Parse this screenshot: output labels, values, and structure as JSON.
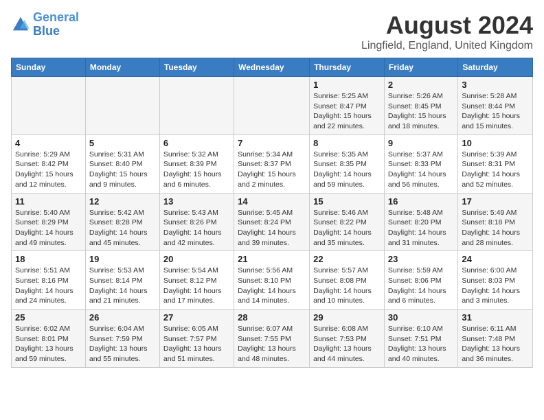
{
  "header": {
    "logo_line1": "General",
    "logo_line2": "Blue",
    "main_title": "August 2024",
    "subtitle": "Lingfield, England, United Kingdom"
  },
  "days_of_week": [
    "Sunday",
    "Monday",
    "Tuesday",
    "Wednesday",
    "Thursday",
    "Friday",
    "Saturday"
  ],
  "weeks": [
    [
      {
        "num": "",
        "info": ""
      },
      {
        "num": "",
        "info": ""
      },
      {
        "num": "",
        "info": ""
      },
      {
        "num": "",
        "info": ""
      },
      {
        "num": "1",
        "info": "Sunrise: 5:25 AM\nSunset: 8:47 PM\nDaylight: 15 hours\nand 22 minutes."
      },
      {
        "num": "2",
        "info": "Sunrise: 5:26 AM\nSunset: 8:45 PM\nDaylight: 15 hours\nand 18 minutes."
      },
      {
        "num": "3",
        "info": "Sunrise: 5:28 AM\nSunset: 8:44 PM\nDaylight: 15 hours\nand 15 minutes."
      }
    ],
    [
      {
        "num": "4",
        "info": "Sunrise: 5:29 AM\nSunset: 8:42 PM\nDaylight: 15 hours\nand 12 minutes."
      },
      {
        "num": "5",
        "info": "Sunrise: 5:31 AM\nSunset: 8:40 PM\nDaylight: 15 hours\nand 9 minutes."
      },
      {
        "num": "6",
        "info": "Sunrise: 5:32 AM\nSunset: 8:39 PM\nDaylight: 15 hours\nand 6 minutes."
      },
      {
        "num": "7",
        "info": "Sunrise: 5:34 AM\nSunset: 8:37 PM\nDaylight: 15 hours\nand 2 minutes."
      },
      {
        "num": "8",
        "info": "Sunrise: 5:35 AM\nSunset: 8:35 PM\nDaylight: 14 hours\nand 59 minutes."
      },
      {
        "num": "9",
        "info": "Sunrise: 5:37 AM\nSunset: 8:33 PM\nDaylight: 14 hours\nand 56 minutes."
      },
      {
        "num": "10",
        "info": "Sunrise: 5:39 AM\nSunset: 8:31 PM\nDaylight: 14 hours\nand 52 minutes."
      }
    ],
    [
      {
        "num": "11",
        "info": "Sunrise: 5:40 AM\nSunset: 8:29 PM\nDaylight: 14 hours\nand 49 minutes."
      },
      {
        "num": "12",
        "info": "Sunrise: 5:42 AM\nSunset: 8:28 PM\nDaylight: 14 hours\nand 45 minutes."
      },
      {
        "num": "13",
        "info": "Sunrise: 5:43 AM\nSunset: 8:26 PM\nDaylight: 14 hours\nand 42 minutes."
      },
      {
        "num": "14",
        "info": "Sunrise: 5:45 AM\nSunset: 8:24 PM\nDaylight: 14 hours\nand 39 minutes."
      },
      {
        "num": "15",
        "info": "Sunrise: 5:46 AM\nSunset: 8:22 PM\nDaylight: 14 hours\nand 35 minutes."
      },
      {
        "num": "16",
        "info": "Sunrise: 5:48 AM\nSunset: 8:20 PM\nDaylight: 14 hours\nand 31 minutes."
      },
      {
        "num": "17",
        "info": "Sunrise: 5:49 AM\nSunset: 8:18 PM\nDaylight: 14 hours\nand 28 minutes."
      }
    ],
    [
      {
        "num": "18",
        "info": "Sunrise: 5:51 AM\nSunset: 8:16 PM\nDaylight: 14 hours\nand 24 minutes."
      },
      {
        "num": "19",
        "info": "Sunrise: 5:53 AM\nSunset: 8:14 PM\nDaylight: 14 hours\nand 21 minutes."
      },
      {
        "num": "20",
        "info": "Sunrise: 5:54 AM\nSunset: 8:12 PM\nDaylight: 14 hours\nand 17 minutes."
      },
      {
        "num": "21",
        "info": "Sunrise: 5:56 AM\nSunset: 8:10 PM\nDaylight: 14 hours\nand 14 minutes."
      },
      {
        "num": "22",
        "info": "Sunrise: 5:57 AM\nSunset: 8:08 PM\nDaylight: 14 hours\nand 10 minutes."
      },
      {
        "num": "23",
        "info": "Sunrise: 5:59 AM\nSunset: 8:06 PM\nDaylight: 14 hours\nand 6 minutes."
      },
      {
        "num": "24",
        "info": "Sunrise: 6:00 AM\nSunset: 8:03 PM\nDaylight: 14 hours\nand 3 minutes."
      }
    ],
    [
      {
        "num": "25",
        "info": "Sunrise: 6:02 AM\nSunset: 8:01 PM\nDaylight: 13 hours\nand 59 minutes."
      },
      {
        "num": "26",
        "info": "Sunrise: 6:04 AM\nSunset: 7:59 PM\nDaylight: 13 hours\nand 55 minutes."
      },
      {
        "num": "27",
        "info": "Sunrise: 6:05 AM\nSunset: 7:57 PM\nDaylight: 13 hours\nand 51 minutes."
      },
      {
        "num": "28",
        "info": "Sunrise: 6:07 AM\nSunset: 7:55 PM\nDaylight: 13 hours\nand 48 minutes."
      },
      {
        "num": "29",
        "info": "Sunrise: 6:08 AM\nSunset: 7:53 PM\nDaylight: 13 hours\nand 44 minutes."
      },
      {
        "num": "30",
        "info": "Sunrise: 6:10 AM\nSunset: 7:51 PM\nDaylight: 13 hours\nand 40 minutes."
      },
      {
        "num": "31",
        "info": "Sunrise: 6:11 AM\nSunset: 7:48 PM\nDaylight: 13 hours\nand 36 minutes."
      }
    ]
  ]
}
